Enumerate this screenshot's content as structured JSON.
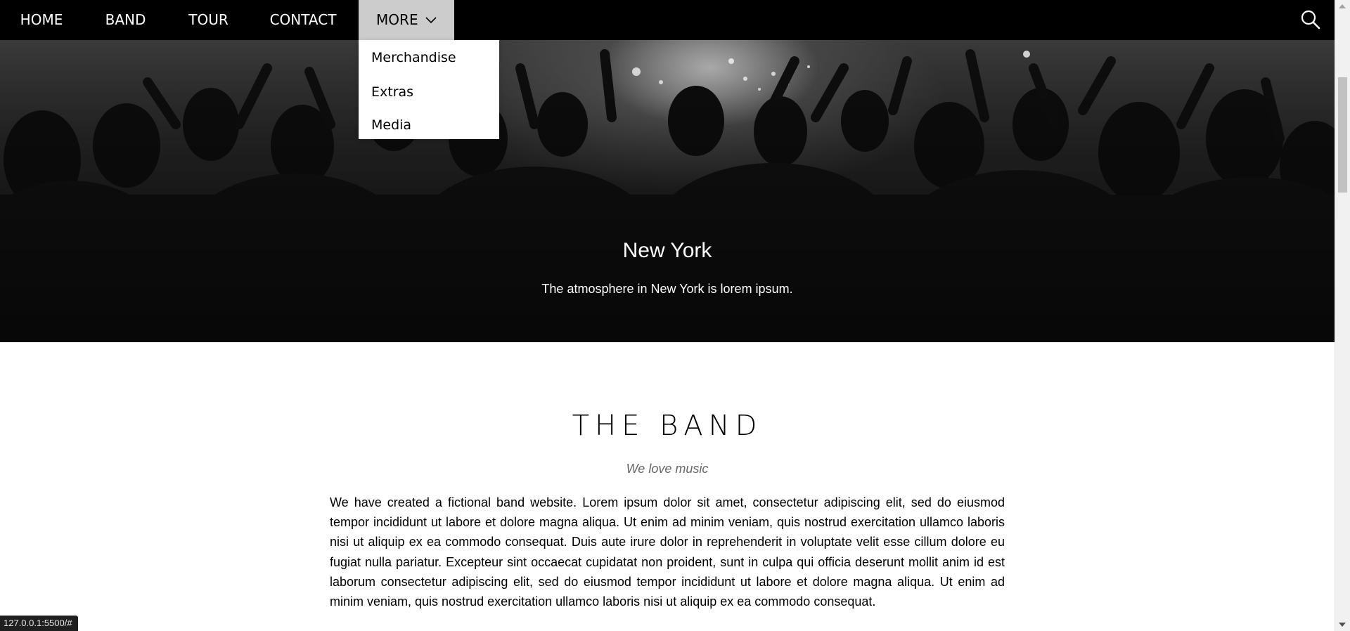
{
  "nav": {
    "items": [
      {
        "label": "HOME"
      },
      {
        "label": "BAND"
      },
      {
        "label": "TOUR"
      },
      {
        "label": "CONTACT"
      },
      {
        "label": "MORE"
      }
    ],
    "more_dropdown": [
      "Merchandise",
      "Extras",
      "Media"
    ],
    "active_color": "#cccccc",
    "background": "#000000"
  },
  "icons": {
    "search": "search-icon",
    "chevron": "chevron-down-icon"
  },
  "hero": {
    "title": "New York",
    "subtitle": "The atmosphere in New York is lorem ipsum."
  },
  "band": {
    "title": "THE BAND",
    "subtitle": "We love music",
    "text": "We have created a fictional band website. Lorem ipsum dolor sit amet, consectetur adipiscing elit, sed do eiusmod tempor incididunt ut labore et dolore magna aliqua. Ut enim ad minim veniam, quis nostrud exercitation ullamco laboris nisi ut aliquip ex ea commodo consequat. Duis aute irure dolor in reprehenderit in voluptate velit esse cillum dolore eu fugiat nulla pariatur. Excepteur sint occaecat cupidatat non proident, sunt in culpa qui officia deserunt mollit anim id est laborum consectetur adipiscing elit, sed do eiusmod tempor incididunt ut labore et dolore magna aliqua. Ut enim ad minim veniam, quis nostrud exercitation ullamco laboris nisi ut aliquip ex ea commodo consequat."
  },
  "status_bar": {
    "url": "127.0.0.1:5500/#"
  }
}
